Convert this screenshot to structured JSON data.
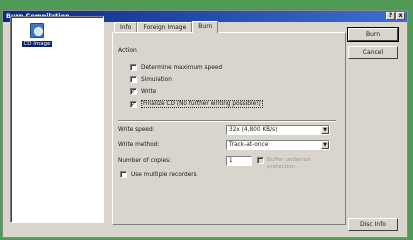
{
  "window": {
    "title": "Burn Compilation",
    "help_label": "?",
    "close_label": "x"
  },
  "sidebar": {
    "items": [
      {
        "label": "CD Image",
        "icon": "cd-image-icon"
      }
    ]
  },
  "tabs": [
    {
      "label": "Info"
    },
    {
      "label": "Foreign Image"
    },
    {
      "label": "Burn",
      "active": true
    }
  ],
  "action": {
    "title": "Action",
    "options": [
      {
        "label": "Determine maximum speed",
        "checked": false
      },
      {
        "label": "Simulation",
        "checked": false
      },
      {
        "label": "Write",
        "checked": true
      },
      {
        "label": "Finalize CD (No further writing possible!)",
        "checked": true
      }
    ]
  },
  "settings": {
    "write_speed_label": "Write speed:",
    "write_speed_value": "32x (4,800 KB/s)",
    "write_method_label": "Write method:",
    "write_method_value": "Track-at-once",
    "copies_label": "Number of copies:",
    "copies_value": "1",
    "underrun_label_1": "Buffer underrun",
    "underrun_label_2": "protection",
    "multiple_recorders_label": "Use multiple recorders"
  },
  "buttons": {
    "burn": "Burn",
    "cancel": "Cancel",
    "disc_info": "Disc Info"
  }
}
